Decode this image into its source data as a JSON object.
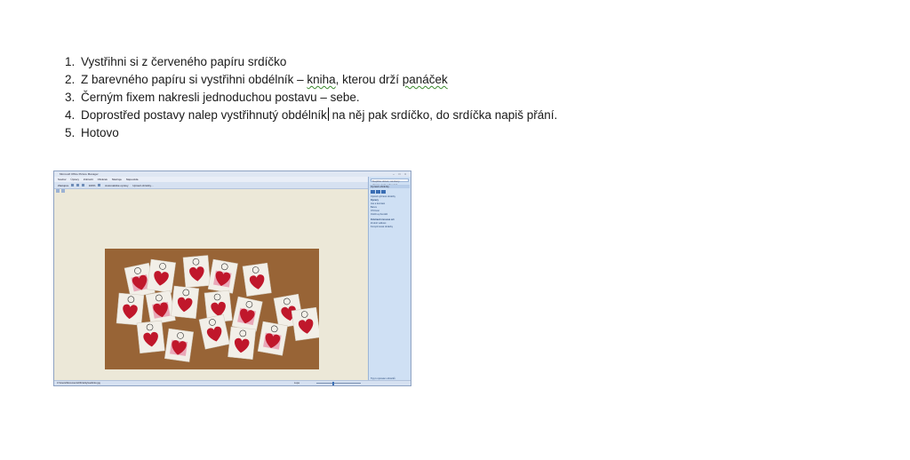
{
  "instructions": [
    {
      "num": "1.",
      "text": "Vystřihni si z červeného papíru srdíčko"
    },
    {
      "num": "2.",
      "text_before": "Z barevného papíru si vystřihni obdélník – ",
      "link_word": "kniha",
      "text_mid": ", kterou drží ",
      "flag_word": "panáček"
    },
    {
      "num": "3.",
      "text": "Černým fixem nakresli jednoduchou postavu – sebe."
    },
    {
      "num": "4.",
      "text_before": "Doprostřed postavy nalep vystřihnutý obdélník",
      "text_after": " na něj pak srdíčko, do srdíčka napiš přání."
    },
    {
      "num": "5.",
      "text": "Hotovo"
    }
  ],
  "screenshot": {
    "window_title": "Microsoft Office Picture Manager",
    "window_controls": "– □ ×",
    "menus": [
      "Soubor",
      "Úpravy",
      "Zobrazit",
      "Obrázek",
      "Nástroje",
      "Nápověda"
    ],
    "toolbar": {
      "shortcuts": "Zástupce",
      "zoom": "100%",
      "auto_correct": "Automatické opravy",
      "edit_pictures": "Upravit obrázky…"
    },
    "search_placeholder": "Napište dotaz, na který chcete znát odpověď",
    "pane_title": "Upravit obrázky",
    "pane_lines": [
      "Upravit vybrané obrázky",
      "Opravy",
      "Jas a kontrast",
      "Barva",
      "Oříznout",
      "Otočit a převrátit",
      "Odstranit červené oči",
      "Změnit velikost",
      "Komprimovat obrázky"
    ],
    "pane_footer": "Tipy k úpravám obrázků",
    "status_path": "C:\\Users\\Documents\\Obrázky\\sardicko.jpg",
    "status_zoom": "Lupa",
    "colors": {
      "heart": "#c0172b",
      "table": "#a06a3a",
      "card": "#f2efe8",
      "pink": "#e9a8b8"
    }
  }
}
